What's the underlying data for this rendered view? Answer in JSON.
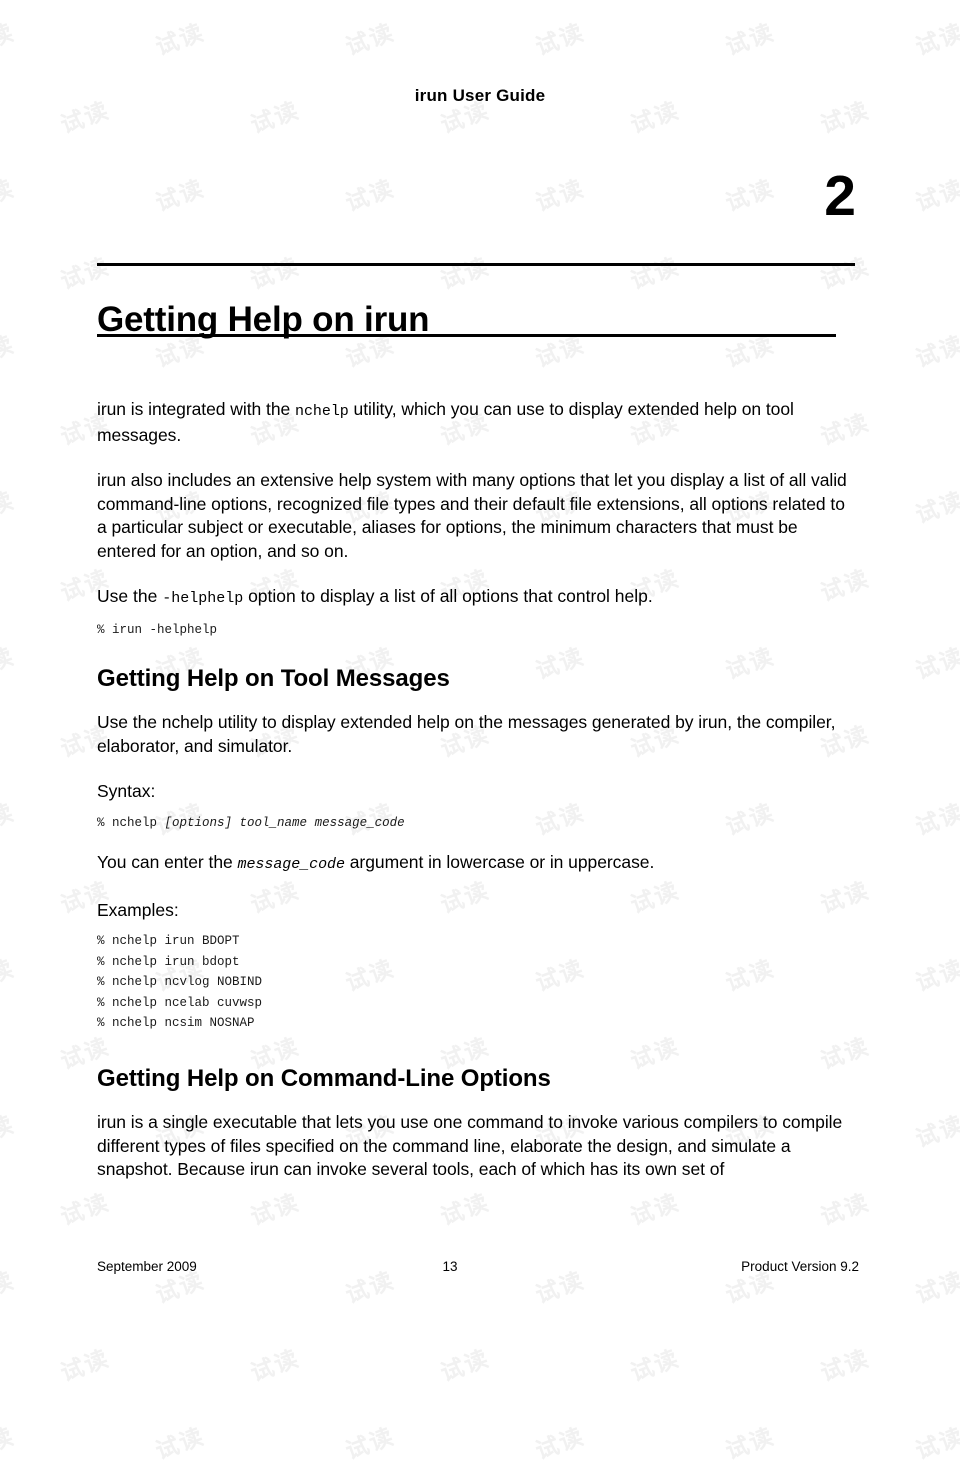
{
  "page": {
    "running_head": "irun User Guide",
    "chapter_number": "2",
    "chapter_title": "Getting Help on irun"
  },
  "intro": {
    "para1_before": "irun is integrated with the ",
    "para1_code": "nchelp",
    "para1_after": " utility, which you can use to display extended help on tool messages.",
    "para2": "irun also includes an extensive help system with many options that let you display a list of all valid command-line options, recognized file types and their default file extensions, all options related to a particular subject or executable, aliases for options, the minimum characters that must be entered for an option, and so on.",
    "para3_before": "Use the ",
    "para3_code": "-helphelp",
    "para3_after": " option to display a list of all options that control help.",
    "code1": "% irun -helphelp"
  },
  "tool_messages": {
    "heading": "Getting Help on Tool Messages",
    "para1": "Use the nchelp utility to display extended help on the messages generated by irun, the compiler, elaborator, and simulator.",
    "syntax_label": "Syntax:",
    "syntax_prompt": "% nchelp ",
    "syntax_options": "[options]",
    "syntax_gap1": " ",
    "syntax_tool_name": "tool_name",
    "syntax_gap2": " ",
    "syntax_message_code": "message_code",
    "para2_before": "You can enter the ",
    "para2_code": "message_code",
    "para2_after": " argument in lowercase or in uppercase.",
    "examples_label": "Examples:",
    "examples": [
      "% nchelp irun BDOPT",
      "% nchelp irun bdopt",
      "% nchelp ncvlog NOBIND",
      "% nchelp ncelab cuvwsp",
      "% nchelp ncsim NOSNAP"
    ]
  },
  "command_line_options": {
    "heading": "Getting Help on Command-Line Options",
    "para1": "irun is a single executable that lets you use one command to invoke various compilers to compile different types of files specified on the command line, elaborate the design, and simulate a snapshot. Because irun can invoke several tools, each of which has its own set of"
  },
  "footer": {
    "left": "September 2009",
    "center": "13",
    "right": "Product Version 9.2"
  },
  "watermark": {
    "text": "试读"
  }
}
